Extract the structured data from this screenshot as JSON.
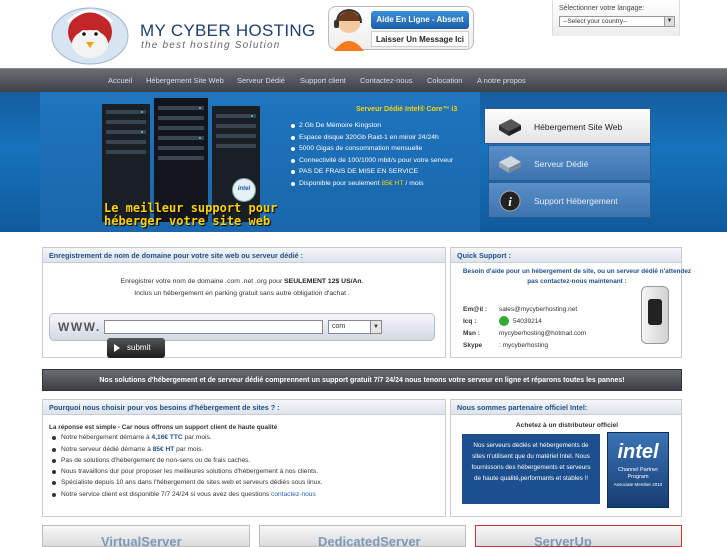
{
  "header": {
    "logo_title_my": "MY",
    "logo_title_rest": "CYBER HOSTING",
    "logo_tagline": "the best hosting Solution",
    "support_status": "Aide En Ligne - Absent",
    "support_message": "Laisser Un Message Ici",
    "language_label": "Sélectionner votre langage:",
    "language_select": "--Select your country--"
  },
  "nav": {
    "items": [
      "Accueil",
      "Hébergement Site Web",
      "Serveur Dédié",
      "Support client",
      "Contactez-nous",
      "Colocation",
      "A notre propos"
    ]
  },
  "banner": {
    "title": "Serveur Dédié Intel® Core™ i3",
    "features": [
      "2 Gb De Mémoire Kingston",
      "Espace disque 320Gb Raid-1 en miroir 24/24h",
      "5000 Gigas de consommation mensuelle",
      "Connectivité de 100/1000 mbit/s pour votre serveur",
      "PAS DE FRAIS DE MISE EN SERVICE"
    ],
    "price_prefix": "Disponible pour seulement ",
    "price": "85€ HT",
    "price_suffix": " / mois",
    "slogan_line1": "Le meilleur support pour",
    "slogan_line2": "héberger votre site web",
    "intel_badge": "intel",
    "tabs": [
      "Hébergement Site Web",
      "Serveur Dédié",
      "Support Hébergement"
    ]
  },
  "domain_panel": {
    "title": "Enregistrement de nom de domaine pour votre site web ou serveur dédié :",
    "line1_prefix": "Enregistrer votre nom de domaine .com .net .org pour ",
    "line1_bold": "SEULEMENT 12$ US/An",
    "line1_suffix": ".",
    "line2": "Inclus un hébergement en parking gratuit sans autre obligation d'achat .",
    "www_label": "WWW.",
    "tld_value": "com",
    "submit_label": "submit"
  },
  "quick_support": {
    "title": "Quick Support :",
    "intro": "Besoin d'aide pour un hébergement de site, ou un serveur dédié n'attendez pas contactez-nous maintenant :",
    "rows": [
      {
        "key": "Em@il :",
        "value": "sales@mycyberhosting.net"
      },
      {
        "key": "Icq :",
        "value": "54039214"
      },
      {
        "key": "Msn :",
        "value": "mycyberhosting@hotmail.com"
      },
      {
        "key": "Skype",
        "value": ": mycyberhosting"
      }
    ]
  },
  "dark_bar": "Nos solutions d'hébergement et de serveur dédié comprennent un support gratuit 7/7 24/24 nous tenons votre serveur en ligne et réparons toutes les pannes!",
  "why_panel": {
    "title": "Pourquoi nous choisir pour vos besoins d'hébergement de sites ? :",
    "intro": "La réponse est simple - Car nous offrons un support client de haute qualité",
    "items": [
      {
        "pre": "Notre hébergement démarre à ",
        "amt": "4,16€ TTC",
        "post": " par mois."
      },
      {
        "pre": "Notre serveur dédié démarre à ",
        "amt": "85€ HT",
        "post": " par mois."
      },
      {
        "pre": "Pas de solutions d'hébergement de non-sens ou de frais cachés.",
        "amt": "",
        "post": ""
      },
      {
        "pre": "Nous travaillons dur pour proposer les meilleures solutions d'hébergement à nos clients.",
        "amt": "",
        "post": ""
      },
      {
        "pre": "Spécialiste depuis 10 ans dans l'hébergement de sites web et serveurs dédiés sous linux.",
        "amt": "",
        "post": ""
      },
      {
        "pre": "Notre service client est disponible 7/7 24/24 si vous avez des questions ",
        "amt": "",
        "post": "",
        "link": "contactez-nous"
      }
    ]
  },
  "intel_panel": {
    "title": "Nous sommes partenaire officiel Intel:",
    "subtitle": "Achetez à un distributeur officiel",
    "box_text": "Nos serveurs dédiés et hébergements de sites n'utilisent que du matériel Intel. Nous fournissons des hébergements et serveurs de haute qualité,performants et stables !!",
    "logo_word": "intel",
    "logo_line1": "Channel Partner",
    "logo_line2": "Program",
    "logo_line3": "Associate Member 2010"
  },
  "thumbs": [
    "VirtualServer",
    "DedicatedServer",
    "ServerUp"
  ],
  "colors": {
    "brand_blue": "#1f4f8c",
    "accent_yellow": "#ffd200",
    "nav_dark": "#3e4247"
  }
}
